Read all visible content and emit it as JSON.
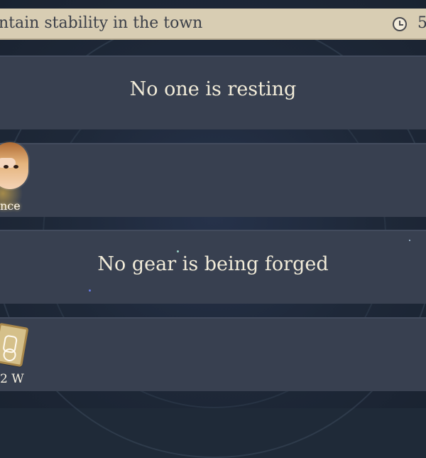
{
  "quest": {
    "text": "ntain stability in the town",
    "timer": "5"
  },
  "panels": [
    {
      "text": "No one is resting"
    },
    {
      "text": ""
    },
    {
      "text": "No gear is being forged"
    },
    {
      "text": ""
    }
  ],
  "hero": {
    "label": "nce"
  },
  "gear": {
    "value": "2 W"
  },
  "colors": {
    "quest_bar": "#d8cdb3",
    "panel": "#384050",
    "text_light": "#f2ecd9"
  }
}
